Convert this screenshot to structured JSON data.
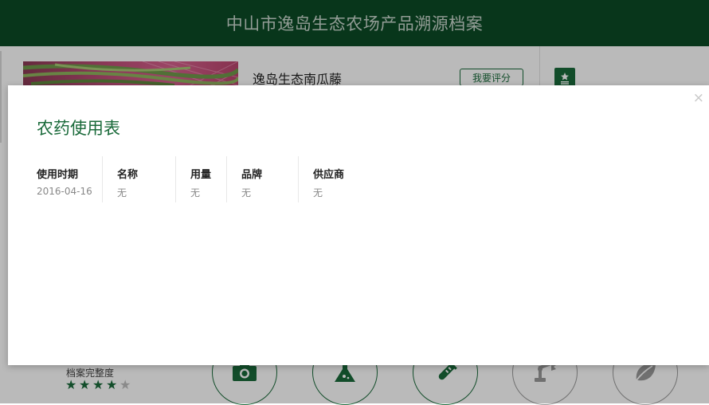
{
  "header": {
    "title": "中山市逸岛生态农场产品溯源档案"
  },
  "product": {
    "name": "逸岛生态南瓜藤",
    "rate_label": "我要评分"
  },
  "completeness": {
    "label": "档案完整度",
    "rating": 4,
    "max": 5
  },
  "feature_icons": [
    "camera-icon",
    "flask-icon",
    "test-tube-icon",
    "robot-arm-icon",
    "leaf-icon"
  ],
  "modal": {
    "title": "农药使用表",
    "close": "×",
    "table": {
      "headers": [
        "使用时期",
        "名称",
        "用量",
        "品牌",
        "供应商"
      ],
      "rows": [
        [
          "2016-04-16",
          "无",
          "无",
          "无",
          "无"
        ]
      ]
    }
  },
  "colors": {
    "brand": "#0b4a26",
    "accent": "#1a6a3a"
  }
}
